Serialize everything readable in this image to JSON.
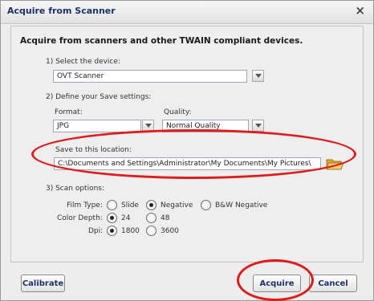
{
  "window": {
    "title": "Acquire from Scanner",
    "close_label": "×"
  },
  "heading": "Acquire from scanners and other TWAIN compliant devices.",
  "step1": {
    "label": "1) Select the device:",
    "device": "OVT Scanner"
  },
  "step2": {
    "label": "2) Define your Save settings:",
    "format_label": "Format:",
    "format_value": "JPG",
    "quality_label": "Quality:",
    "quality_value": "Normal Quality",
    "location_label": "Save to this location:",
    "location_value": "C:\\Documents and Settings\\Administrator\\My Documents\\My Pictures\\"
  },
  "step3": {
    "label": "3) Scan options:",
    "film_type_label": "Film Type:",
    "film_types": [
      "Slide",
      "Negative",
      "B&W Negative"
    ],
    "film_type_selected": "Negative",
    "color_depth_label": "Color Depth:",
    "color_depths": [
      "24",
      "48"
    ],
    "color_depth_selected": "24",
    "dpi_label": "Dpi:",
    "dpis": [
      "1800",
      "3600"
    ],
    "dpi_selected": "1800"
  },
  "buttons": {
    "calibrate": "Calibrate",
    "acquire": "Acquire",
    "cancel": "Cancel"
  },
  "colors": {
    "annotation": "#e01b1b",
    "title_text": "#1e2f6b",
    "folder": "#e9c35a"
  }
}
